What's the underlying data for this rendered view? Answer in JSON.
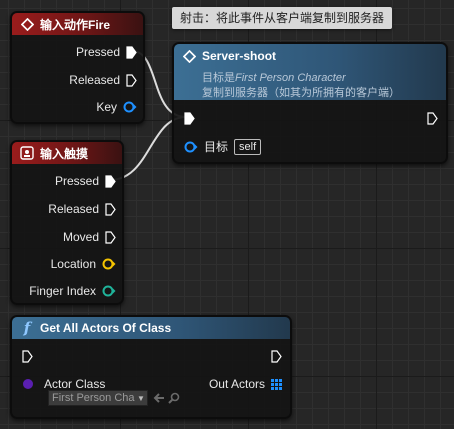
{
  "tooltip": {
    "text": "射击：将此事件从客户端复制到服务器"
  },
  "input_fire_node": {
    "title": "输入动作Fire",
    "pins": {
      "pressed": "Pressed",
      "released": "Released",
      "key": "Key"
    },
    "header_color": "#9a1c1c"
  },
  "input_touch_node": {
    "title": "输入触摸",
    "pins": {
      "pressed": "Pressed",
      "released": "Released",
      "moved": "Moved",
      "location": "Location",
      "finger_index": "Finger Index"
    },
    "header_color": "#9a1c1c"
  },
  "server_shoot_node": {
    "title": "Server-shoot",
    "subtitle_prefix": "目标是",
    "subtitle_target": "First Person Character",
    "subtitle2": "复制到服务器（如其为所拥有的客户端）",
    "target_label": "目标",
    "target_value": "self",
    "header_color": "#3c6f94"
  },
  "get_all_actors_node": {
    "title": "Get All Actors Of Class",
    "actor_class_label": "Actor Class",
    "actor_class_value": "First Person Cha",
    "out_actors_label": "Out Actors",
    "header_color": "#3c6f94"
  },
  "colors": {
    "exec_pin": "#ffffff",
    "object_pin": "#1e90ff",
    "vector_pin": "#f5c400",
    "int_pin": "#1fb39a",
    "class_pin": "#5a1fb0",
    "array_pin": "#1e90ff"
  },
  "icons": [
    "event-diamond-icon",
    "touch-event-icon",
    "function-f-icon",
    "exec-pin-icon",
    "object-pin-icon",
    "array-pin-icon",
    "back-arrow-icon",
    "search-icon"
  ]
}
